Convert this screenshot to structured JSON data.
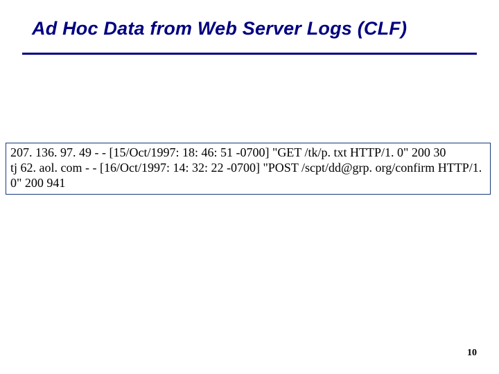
{
  "slide": {
    "title": "Ad Hoc Data from Web Server Logs (CLF)",
    "page_number": "10"
  },
  "log": {
    "line1": "207. 136. 97. 49 - - [15/Oct/1997: 18: 46: 51 -0700] \"GET /tk/p. txt HTTP/1. 0\" 200 30",
    "line2": "tj 62. aol. com - - [16/Oct/1997: 14: 32: 22 -0700] \"POST /scpt/dd@grp. org/confirm HTTP/1. 0\" 200 941"
  }
}
